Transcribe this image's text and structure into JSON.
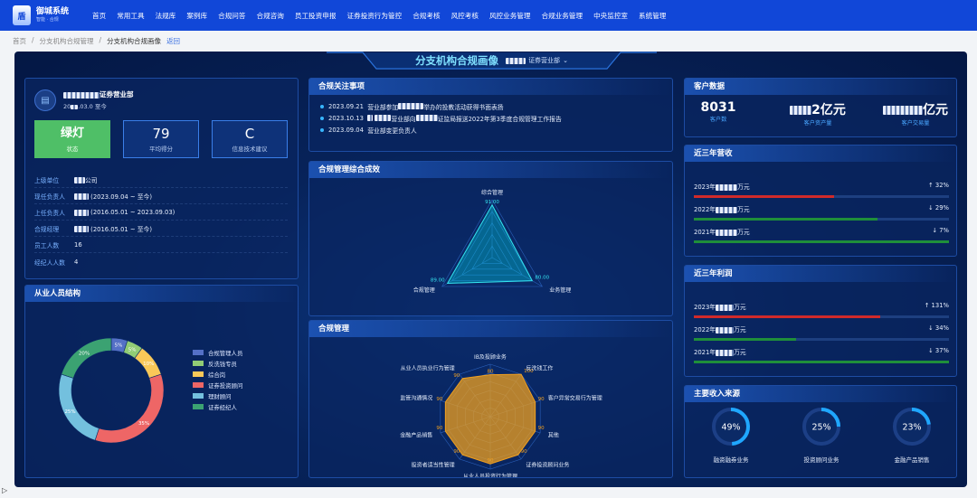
{
  "app": {
    "name": "御城系统",
    "subtitle": "智能 · 合规"
  },
  "nav": [
    "首页",
    "常用工具",
    "法规库",
    "案例库",
    "合规问答",
    "合规咨询",
    "员工投资申报",
    "证券投资行为管控",
    "合规考核",
    "风控考核",
    "风控业务管理",
    "合规业务管理",
    "中央监控室",
    "系统管理"
  ],
  "breadcrumb": {
    "items": [
      "首页",
      "分支机构合规管理",
      "分支机构合规画像"
    ],
    "back": "返回"
  },
  "dashboard": {
    "title": "分支机构合规画像",
    "org_suffix": "证券营业部"
  },
  "profile": {
    "name_suffix": "证券营业部",
    "date_prefix": "20",
    "date_suffix": ".03.0   至今",
    "metrics": [
      {
        "value": "绿灯",
        "label": "状态"
      },
      {
        "value": "79",
        "label": "平均得分"
      },
      {
        "value": "C",
        "label": "信息技术建议"
      }
    ],
    "info": [
      {
        "k": "上级单位",
        "v": "公司"
      },
      {
        "k": "现任负责人",
        "v": "(2023.09.04 ~ 至今)"
      },
      {
        "k": "上任负责人",
        "v": "(2016.05.01 ~ 2023.09.03)"
      },
      {
        "k": "合规经理",
        "v": "(2016.05.01 ~ 至今)"
      },
      {
        "k": "员工人数",
        "v": "16"
      },
      {
        "k": "经纪人人数",
        "v": "4"
      }
    ]
  },
  "staff": {
    "title": "从业人员结构",
    "legend": [
      "合规管理人员",
      "反洗钱专员",
      "综合岗",
      "证券投资顾问",
      "理财顾问",
      "证券经纪人"
    ]
  },
  "notices": {
    "title": "合规关注事项",
    "items": [
      {
        "date": "2023.09.21",
        "text": "营业部参加",
        "tail": "举办的投教活动获得书面表扬"
      },
      {
        "date": "2023.10.13",
        "text": "营业部向",
        "tail": "证监局报送2022年第3季度合规管理工作报告"
      },
      {
        "date": "2023.09.04",
        "text": "营业部变更负责人",
        "tail": ""
      }
    ]
  },
  "effect": {
    "title": "合规管理综合成效"
  },
  "manage": {
    "title": "合规管理"
  },
  "customers": {
    "title": "客户数据",
    "items": [
      {
        "value": "8031",
        "label": "客户数"
      },
      {
        "value": "2亿元",
        "label": "客户资产量"
      },
      {
        "value": "亿元",
        "label": "客户交易量"
      }
    ]
  },
  "revenue": {
    "title": "近三年营收",
    "rows": [
      {
        "year": "2023年",
        "unit": "万元",
        "change": "↑ 32%",
        "ratio": 0.55,
        "color": "#d02a2a"
      },
      {
        "year": "2022年",
        "unit": "万元",
        "change": "↓ 29%",
        "ratio": 0.72,
        "color": "#1f8f3a"
      },
      {
        "year": "2021年",
        "unit": "万元",
        "change": "↓ 7%",
        "ratio": 1.0,
        "color": "#1f8f3a"
      }
    ]
  },
  "profit": {
    "title": "近三年利润",
    "rows": [
      {
        "year": "2023年",
        "unit": "万元",
        "change": "↑ 131%",
        "ratio": 0.73,
        "color": "#d02a2a"
      },
      {
        "year": "2022年",
        "unit": "万元",
        "change": "↓ 34%",
        "ratio": 0.4,
        "color": "#1f8f3a"
      },
      {
        "year": "2021年",
        "unit": "万元",
        "change": "↓ 37%",
        "ratio": 1.0,
        "color": "#1f8f3a"
      }
    ]
  },
  "income": {
    "title": "主要收入来源",
    "items": [
      {
        "pct": "49%",
        "label": "融资融券业务",
        "ratio": 0.49
      },
      {
        "pct": "25%",
        "label": "投资顾问业务",
        "ratio": 0.25
      },
      {
        "pct": "23%",
        "label": "金融产品销售",
        "ratio": 0.23
      }
    ]
  },
  "chart_data": [
    {
      "type": "pie",
      "title": "从业人员结构",
      "categories": [
        "合规管理人员",
        "反洗钱专员",
        "综合岗",
        "证券投资顾问",
        "理财顾问",
        "证券经纪人"
      ],
      "values": [
        5,
        5,
        10,
        35,
        25,
        20
      ],
      "colors": [
        "#5470c6",
        "#91cc75",
        "#fac858",
        "#ee6666",
        "#73c0de",
        "#3ba272"
      ]
    },
    {
      "type": "radar",
      "title": "合规管理综合成效",
      "categories": [
        "综合管理",
        "业务管理",
        "合规管理"
      ],
      "values": [
        91,
        80,
        89
      ]
    },
    {
      "type": "radar",
      "title": "合规管理",
      "categories": [
        "IB及投顾业务",
        "反洗钱工作",
        "客户异常交易行为管理",
        "其他",
        "证券投资顾问业务",
        "从业人员投资行为管理",
        "投资者适当性管理",
        "金融产品销售",
        "监管沟通情况",
        "从业人员执业行为管理"
      ],
      "values": [
        80,
        100,
        90,
        90,
        90,
        90,
        90,
        90,
        90,
        90
      ]
    }
  ]
}
